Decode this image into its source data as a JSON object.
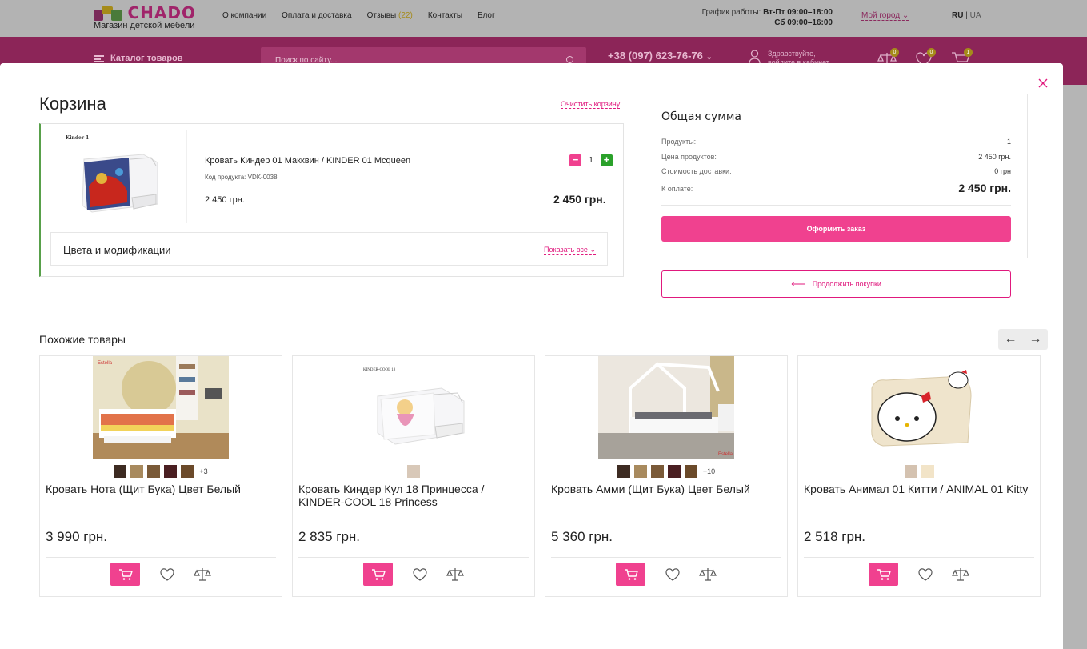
{
  "header": {
    "logo_text": "CHADO",
    "logo_sub": "Магазин детской мебели",
    "nav": [
      {
        "label": "О компании"
      },
      {
        "label": "Оплата и доставка"
      },
      {
        "label": "Отзывы",
        "count": "(22)"
      },
      {
        "label": "Контакты"
      },
      {
        "label": "Блог"
      }
    ],
    "hours_label": "График работы:",
    "hours_weekdays": "Вт-Пт 09:00–18:00",
    "hours_saturday": "Сб 09:00–16:00",
    "city": "Мой город",
    "lang_active": "RU",
    "lang_sep": " | ",
    "lang_alt": "UA",
    "catalog": "Каталог товаров",
    "search_placeholder": "Поиск по сайту...",
    "phone": "+38 (097) 623-76-76",
    "greeting_line1": "Здравствуйте,",
    "greeting_line2": "войдите в кабинет",
    "compare_count": "0",
    "wishlist_count": "0",
    "cart_count": "1"
  },
  "cart": {
    "title": "Корзина",
    "clear": "Очистить корзину",
    "item": {
      "image_label": "Kinder 1",
      "name": "Кровать Киндер 01 Макквин / KINDER 01 Mcqueen",
      "code": "Код продукта: VDK-0038",
      "price": "2 450 грн.",
      "total": "2 450 грн.",
      "qty": "1",
      "mods_title": "Цвета и модификации",
      "mods_show": "Показать все"
    }
  },
  "summary": {
    "title": "Общая сумма",
    "rows": [
      {
        "label": "Продукты:",
        "value": "1"
      },
      {
        "label": "Цена продуктов:",
        "value": "2 450 грн."
      },
      {
        "label": "Стоимость доставки:",
        "value": "0 грн"
      },
      {
        "label": "К оплате:",
        "value": "2 450 грн."
      }
    ],
    "order_button": "Оформить заказ",
    "continue_button": "Продолжить покупки"
  },
  "similar": {
    "title": "Похожие товары",
    "products": [
      {
        "name": "Кровать Нота (Щит Бука) Цвет Белый",
        "price": "3 990 грн.",
        "swatches": [
          "#3d2b22",
          "#a88a5e",
          "#7a5a38",
          "#4a1f22",
          "#6b4a2a"
        ],
        "more": "+3"
      },
      {
        "name": "Кровать Киндер Кул 18 Принцесса / KINDER-COOL 18 Princess",
        "price": "2 835 грн.",
        "swatches": [
          "#d8c8b8"
        ],
        "more": "",
        "image_label": "KINDER-COOL 18"
      },
      {
        "name": "Кровать Амми (Щит Бука) Цвет Белый",
        "price": "5 360 грн.",
        "swatches": [
          "#3d2b22",
          "#a88a5e",
          "#7a5a38",
          "#4a1f22",
          "#6b4a2a"
        ],
        "more": "+10"
      },
      {
        "name": "Кровать Анимал 01 Китти / ANIMAL 01 Kitty",
        "price": "2 518 грн.",
        "swatches": [
          "#d4c2b0",
          "#f2e4c8"
        ],
        "more": ""
      }
    ]
  },
  "colors": {
    "accent": "#f0418f",
    "accent_link": "#e0197d",
    "plus": "#2aa12a",
    "item_border": "#58a04a"
  }
}
